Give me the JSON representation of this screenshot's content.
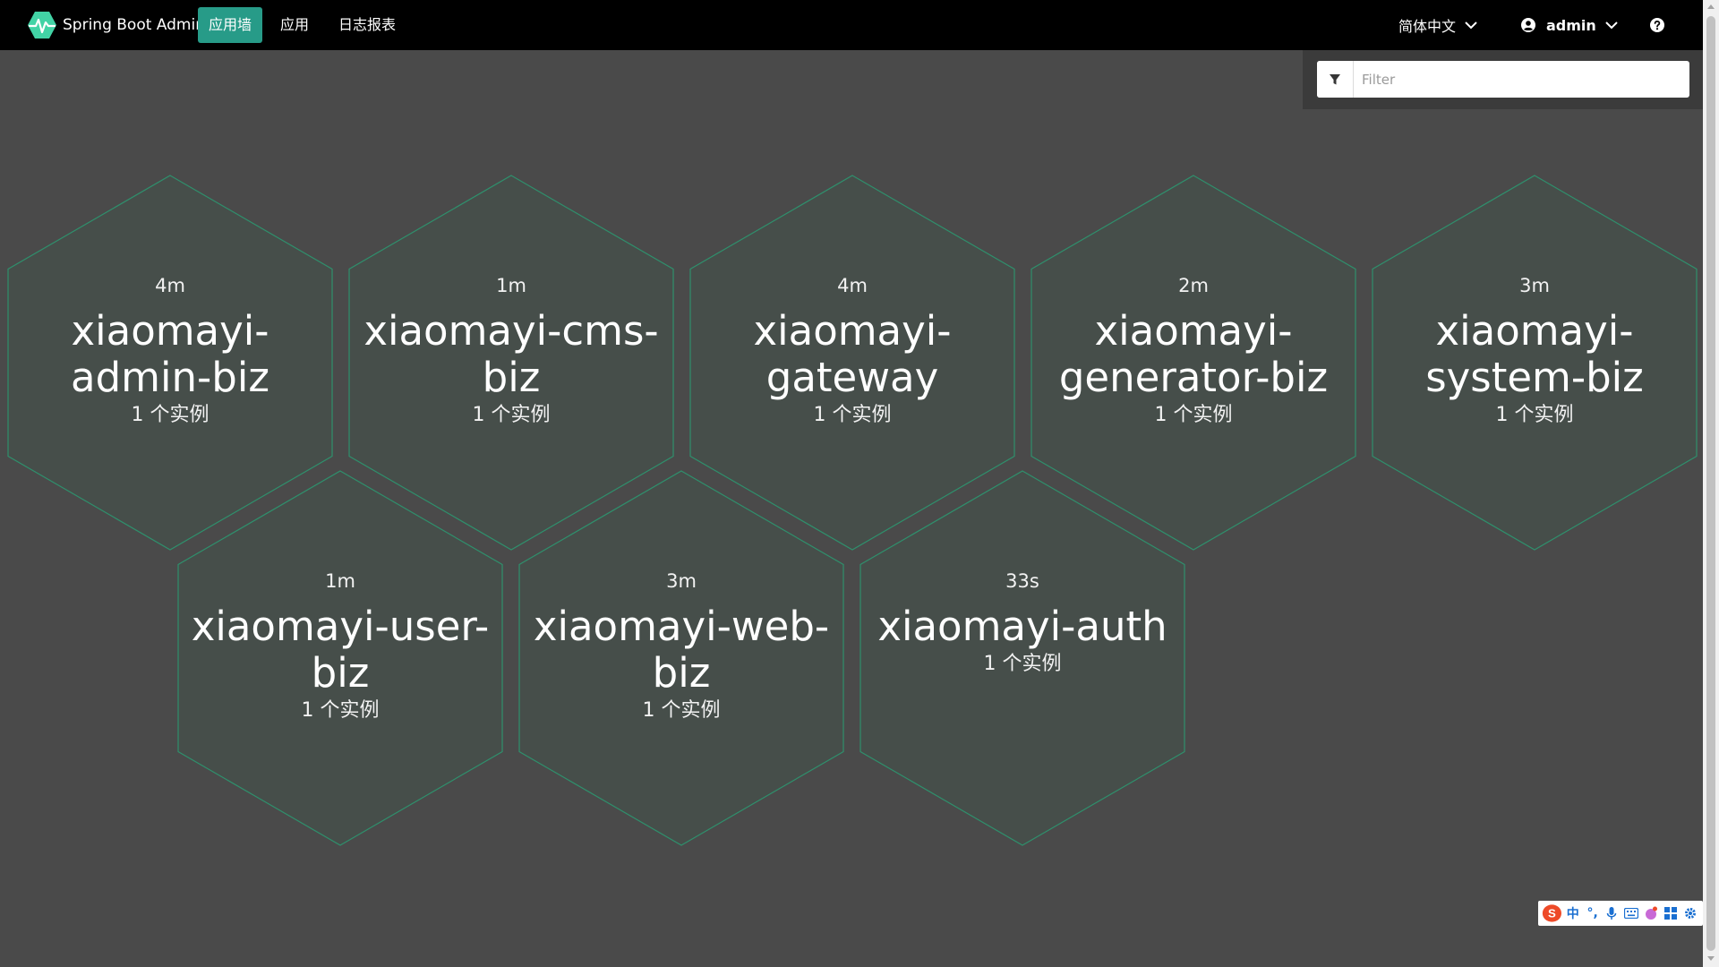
{
  "navbar": {
    "brand": "Spring Boot Admin",
    "items": [
      {
        "label": "应用墙",
        "active": true
      },
      {
        "label": "应用",
        "active": false
      },
      {
        "label": "日志报表",
        "active": false
      }
    ],
    "language": "简体中文",
    "user": "admin",
    "help_icon": "question-circle-icon"
  },
  "filter": {
    "placeholder": "Filter",
    "icon": "filter-icon"
  },
  "applications": [
    {
      "time": "4m",
      "name": "xiaomayi-admin-biz",
      "instances": "1 个实例"
    },
    {
      "time": "1m",
      "name": "xiaomayi-cms-biz",
      "instances": "1 个实例"
    },
    {
      "time": "4m",
      "name": "xiaomayi-gateway",
      "instances": "1 个实例"
    },
    {
      "time": "2m",
      "name": "xiaomayi-generator-biz",
      "instances": "1 个实例"
    },
    {
      "time": "3m",
      "name": "xiaomayi-system-biz",
      "instances": "1 个实例"
    },
    {
      "time": "1m",
      "name": "xiaomayi-user-biz",
      "instances": "1 个实例"
    },
    {
      "time": "3m",
      "name": "xiaomayi-web-biz",
      "instances": "1 个实例"
    },
    {
      "time": "33s",
      "name": "xiaomayi-auth",
      "instances": "1 个实例"
    }
  ],
  "colors": {
    "accent": "#279b88",
    "hex_fill": "#464e4a",
    "hex_stroke": "#2f8f6c",
    "background": "#4a4a4a",
    "navbar": "#000000"
  },
  "ime": {
    "items": [
      "中",
      "°,",
      "mic-icon",
      "keyboard-icon",
      "skin-icon",
      "grid-icon",
      "settings-icon"
    ]
  }
}
